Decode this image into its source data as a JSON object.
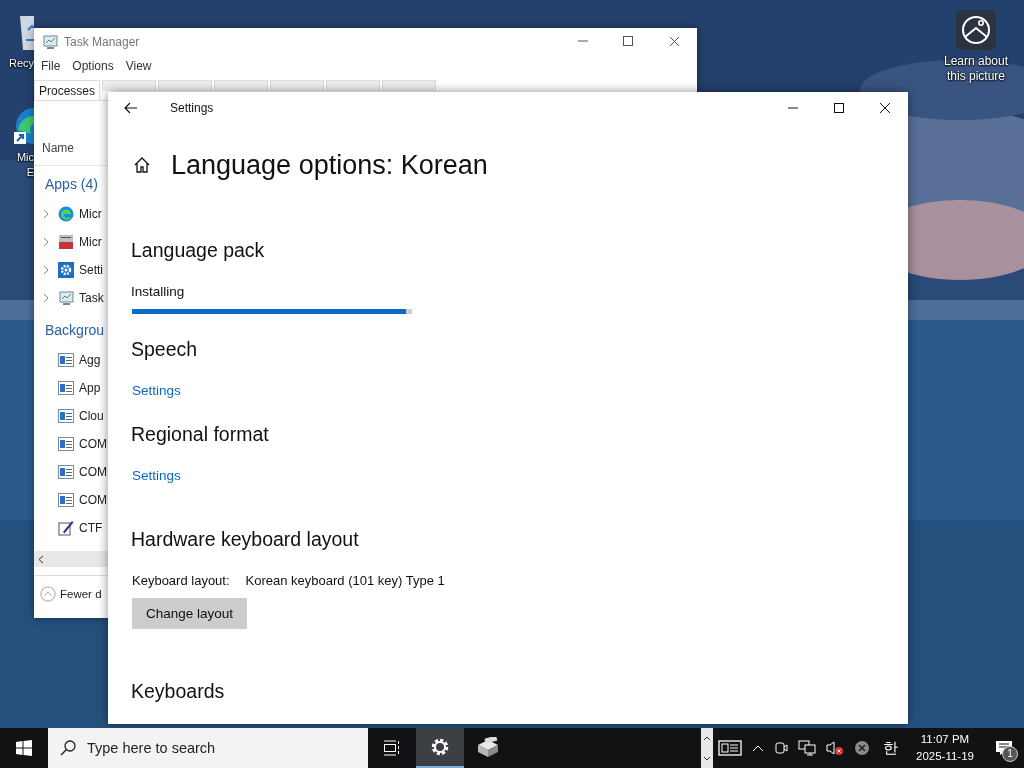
{
  "desktop": {
    "icons": [
      {
        "kind": "recycle",
        "lines": [
          "Recy"
        ]
      },
      {
        "kind": "edge",
        "lines": [
          "Mic",
          "E"
        ]
      }
    ],
    "spotlight": {
      "label": "Learn about this picture"
    }
  },
  "task_manager": {
    "title": "Task Manager",
    "menu": [
      "File",
      "Options",
      "View"
    ],
    "tabs": [
      {
        "label": "Processes",
        "selected": true
      },
      {
        "selected": false
      },
      {
        "selected": false
      },
      {
        "selected": false
      },
      {
        "selected": false
      },
      {
        "selected": false
      },
      {
        "selected": false
      }
    ],
    "column": "Name",
    "groups": [
      {
        "kind": "apps",
        "title": "Apps (4)",
        "items": [
          {
            "kind": "browser",
            "name": "Micr"
          },
          {
            "kind": "toolbox",
            "name": "Micr"
          },
          {
            "kind": "settings",
            "name": "Setti"
          },
          {
            "kind": "monitor",
            "name": "Task"
          }
        ]
      },
      {
        "kind": "background",
        "title": "Backgrou",
        "items": [
          {
            "kind": "service",
            "name": "Agg"
          },
          {
            "kind": "service",
            "name": "App"
          },
          {
            "kind": "service",
            "name": "Clou"
          },
          {
            "kind": "service",
            "name": "COM"
          },
          {
            "kind": "service",
            "name": "COM"
          },
          {
            "kind": "service",
            "name": "COM"
          },
          {
            "kind": "editor",
            "name": "CTF"
          }
        ]
      }
    ],
    "footer": "Fewer d"
  },
  "settings": {
    "title": "Settings",
    "heading": "Language options: Korean",
    "sections": [
      {
        "kind": "progress",
        "title": "Language pack",
        "status": "Installing",
        "level": 0.98
      },
      {
        "kind": "link",
        "title": "Speech",
        "link": "Settings"
      },
      {
        "kind": "link",
        "title": "Regional format",
        "link": "Settings"
      },
      {
        "kind": "keyboard",
        "title": "Hardware keyboard layout",
        "label": "Keyboard layout:",
        "value": "Korean keyboard (101 key) Type 1",
        "button": "Change layout"
      },
      {
        "kind": "heading",
        "title": "Keyboards"
      }
    ]
  },
  "taskbar": {
    "search": {
      "placeholder": "Type here to search"
    },
    "apps": [
      {
        "kind": "settings",
        "selected": true
      },
      {
        "kind": "package",
        "selected": false
      }
    ],
    "ime": "한",
    "time": "11:07 PM",
    "date": "2025-11-19",
    "notifications": "1"
  }
}
